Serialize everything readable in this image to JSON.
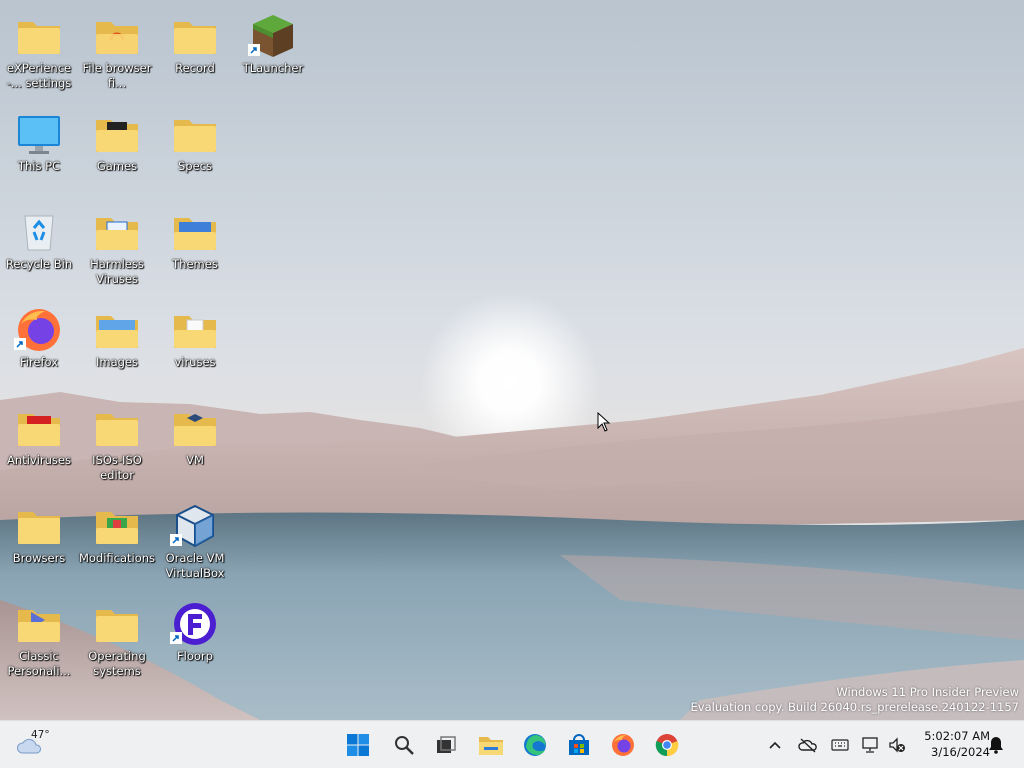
{
  "desktop_icons": [
    {
      "label": "eXPerience -... settings"
    },
    {
      "label": "File browser fi..."
    },
    {
      "label": "Record"
    },
    {
      "label": "TLauncher"
    },
    {
      "label": "This PC"
    },
    {
      "label": "Games"
    },
    {
      "label": "Specs"
    },
    {
      "label": "Recycle Bin"
    },
    {
      "label": "Harmless Viruses"
    },
    {
      "label": "Themes"
    },
    {
      "label": "Firefox"
    },
    {
      "label": "Images"
    },
    {
      "label": "viruses"
    },
    {
      "label": "Antiviruses"
    },
    {
      "label": "ISOs-ISO editor"
    },
    {
      "label": "VM"
    },
    {
      "label": "Browsers"
    },
    {
      "label": "Modifications"
    },
    {
      "label": "Oracle VM VirtualBox"
    },
    {
      "label": "Classic Personali..."
    },
    {
      "label": "Operating systems"
    },
    {
      "label": "Floorp"
    }
  ],
  "watermark": {
    "line1": "Windows 11 Pro Insider Preview",
    "line2": "Evaluation copy. Build 26040.rs_prerelease.240122-1157"
  },
  "taskbar": {
    "weather": {
      "temp": "47°",
      "icon": "cloud-icon"
    },
    "pinned": [
      {
        "name": "start",
        "icon": "windows-logo-icon"
      },
      {
        "name": "search",
        "icon": "search-icon"
      },
      {
        "name": "task-view",
        "icon": "task-view-icon"
      },
      {
        "name": "file-explorer",
        "icon": "folder-icon"
      },
      {
        "name": "edge",
        "icon": "edge-icon"
      },
      {
        "name": "store",
        "icon": "store-icon"
      },
      {
        "name": "firefox",
        "icon": "firefox-icon"
      },
      {
        "name": "chrome",
        "icon": "chrome-icon"
      }
    ],
    "tray": [
      "chevron-up-icon",
      "onedrive-icon",
      "keyboard-icon",
      "network-icon",
      "volume-muted-icon"
    ],
    "clock": {
      "time": "5:02:07 AM",
      "date": "3/16/2024"
    }
  },
  "colors": {
    "folder": "#f8d775",
    "folder_dark": "#e6b94d",
    "taskbar_bg": "#eef0f2",
    "accent_blue": "#0067c0"
  }
}
